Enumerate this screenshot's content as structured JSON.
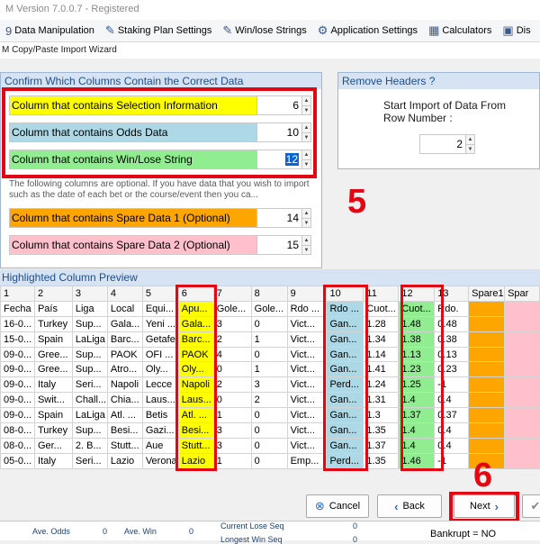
{
  "window": {
    "title": "M Version 7.0.0.7 - Registered"
  },
  "toolbar": [
    {
      "icon": "9",
      "label": "Data Manipulation"
    },
    {
      "icon": "✎",
      "label": "Staking Plan Settings"
    },
    {
      "icon": "✎",
      "label": "Win/lose Strings"
    },
    {
      "icon": "⚙",
      "label": "Application Settings"
    },
    {
      "icon": "▦",
      "label": "Calculators"
    },
    {
      "icon": "▣",
      "label": "Dis"
    }
  ],
  "wizard_title": "M Copy/Paste Import Wizard",
  "confirm_panel": {
    "header": "Confirm Which Columns Contain the Correct Data",
    "rows": [
      {
        "label": "Column that contains Selection Information",
        "value": "6",
        "color": "#ffff00"
      },
      {
        "label": "Column that contains Odds Data",
        "value": "10",
        "color": "#add8e6"
      },
      {
        "label": "Column that contains Win/Lose String",
        "value": "12",
        "color": "#90ee90"
      },
      {
        "label": "Column that contains Spare Data 1 (Optional)",
        "value": "14",
        "color": "#ffa500"
      },
      {
        "label": "Column that contains Spare Data 2 (Optional)",
        "value": "15",
        "color": "#ffc0cb"
      }
    ],
    "note": "The following columns are optional. If you have data that you wish to import such as the date of each bet or the course/event then you ca..."
  },
  "headers_panel": {
    "header": "Remove Headers ?",
    "label": "Start Import of Data From Row Number :",
    "value": "2"
  },
  "preview": {
    "header": "Highlighted Column Preview",
    "columns": [
      "1",
      "2",
      "3",
      "4",
      "5",
      "6",
      "7",
      "8",
      "9",
      "10",
      "11",
      "12",
      "13",
      "Spare1",
      "Spar"
    ],
    "rows": [
      [
        "Fecha",
        "País",
        "Liga",
        "Local",
        "Equi...",
        "Apu...",
        "Gole...",
        "Gole...",
        "Rdo ...",
        "Rdo ...",
        "Cuot...",
        "Cuot...",
        "Rdo.",
        "",
        ""
      ],
      [
        "16-0...",
        "Turkey",
        "Sup...",
        "Gala...",
        "Yeni ...",
        "Gala...",
        "3",
        "0",
        "Vict...",
        "Gan...",
        "1.28",
        "1.48",
        "0.48",
        "",
        ""
      ],
      [
        "15-0...",
        "Spain",
        "LaLiga",
        "Barc...",
        "Getafe",
        "Barc...",
        "2",
        "1",
        "Vict...",
        "Gan...",
        "1.34",
        "1.38",
        "0.38",
        "",
        ""
      ],
      [
        "09-0...",
        "Gree...",
        "Sup...",
        "PAOK",
        "OFI ...",
        "PAOK",
        "4",
        "0",
        "Vict...",
        "Gan...",
        "1.14",
        "1.13",
        "0.13",
        "",
        ""
      ],
      [
        "09-0...",
        "Gree...",
        "Sup...",
        "Atro...",
        "Oly...",
        "Oly...",
        "0",
        "1",
        "Vict...",
        "Gan...",
        "1.41",
        "1.23",
        "0.23",
        "",
        ""
      ],
      [
        "09-0...",
        "Italy",
        "Seri...",
        "Napoli",
        "Lecce",
        "Napoli",
        "2",
        "3",
        "Vict...",
        "Perd...",
        "1.24",
        "1.25",
        "-1",
        "",
        ""
      ],
      [
        "09-0...",
        "Swit...",
        "Chall...",
        "Chia...",
        "Laus...",
        "Laus...",
        "0",
        "2",
        "Vict...",
        "Gan...",
        "1.31",
        "1.4",
        "0.4",
        "",
        ""
      ],
      [
        "09-0...",
        "Spain",
        "LaLiga",
        "Atl. ...",
        "Betis",
        "Atl. ...",
        "1",
        "0",
        "Vict...",
        "Gan...",
        "1.3",
        "1.37",
        "0.37",
        "",
        ""
      ],
      [
        "08-0...",
        "Turkey",
        "Sup...",
        "Besi...",
        "Gazi...",
        "Besi...",
        "3",
        "0",
        "Vict...",
        "Gan...",
        "1.35",
        "1.4",
        "0.4",
        "",
        ""
      ],
      [
        "08-0...",
        "Ger...",
        "2. B...",
        "Stutt...",
        "Aue",
        "Stutt...",
        "3",
        "0",
        "Vict...",
        "Gan...",
        "1.37",
        "1.4",
        "0.4",
        "",
        ""
      ],
      [
        "05-0...",
        "Italy",
        "Seri...",
        "Lazio",
        "Verona",
        "Lazio",
        "1",
        "0",
        "Emp...",
        "Perd...",
        "1.35",
        "1.46",
        "-1",
        "",
        ""
      ]
    ]
  },
  "annotations": [
    "5",
    "6"
  ],
  "buttons": {
    "cancel": "Cancel",
    "back": "Back",
    "next": "Next"
  },
  "status": {
    "ave_odds": "Ave. Odds",
    "ave_odds_val": "0",
    "ave_win": "Ave. Win",
    "ave_win_val": "0",
    "current_lose_seq": "Current Lose Seq",
    "current_lose_seq_val": "0",
    "longest_win_seq": "Longest Win Seq",
    "longest_win_seq_val": "0",
    "bankrupt": "Bankrupt = NO"
  }
}
